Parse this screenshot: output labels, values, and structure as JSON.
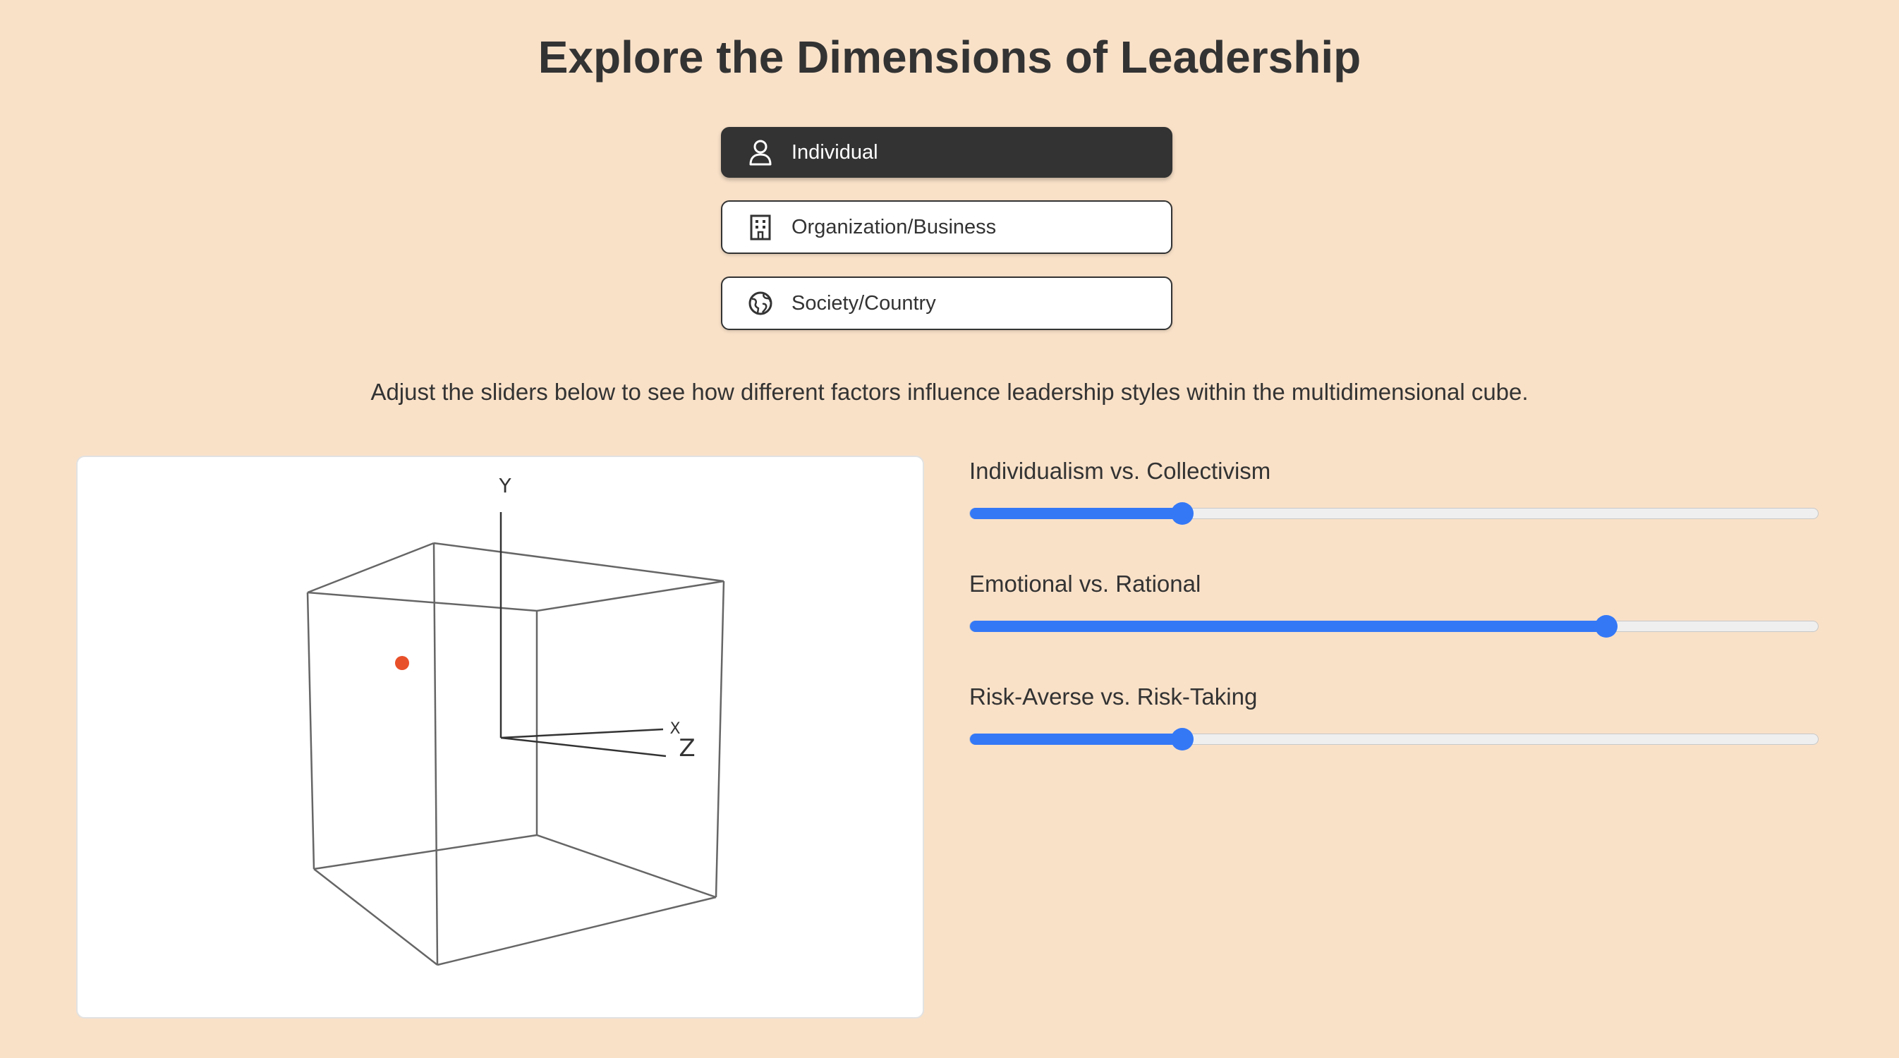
{
  "page": {
    "title": "Explore the Dimensions of Leadership",
    "instructions": "Adjust the sliders below to see how different factors influence leadership styles within the multidimensional cube."
  },
  "levels": [
    {
      "label": "Individual",
      "icon": "person-icon",
      "selected": true
    },
    {
      "label": "Organization/Business",
      "icon": "building-icon",
      "selected": false
    },
    {
      "label": "Society/Country",
      "icon": "globe-icon",
      "selected": false
    }
  ],
  "cube": {
    "axis_labels": {
      "x": "X",
      "y": "Y",
      "z": "Z"
    },
    "point_color": "#e8502a"
  },
  "sliders": [
    {
      "label": "Individualism vs. Collectivism",
      "value": 25,
      "min": 0,
      "max": 100
    },
    {
      "label": "Emotional vs. Rational",
      "value": 75,
      "min": 0,
      "max": 100
    },
    {
      "label": "Risk-Averse vs. Risk-Taking",
      "value": 25,
      "min": 0,
      "max": 100
    }
  ],
  "colors": {
    "background": "#f9e1c8",
    "accent": "#3478f6",
    "dark": "#333333"
  }
}
